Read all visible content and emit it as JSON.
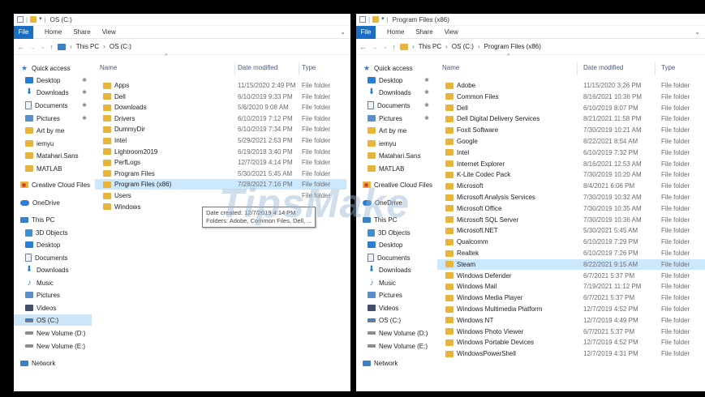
{
  "left": {
    "title": "OS (C:)",
    "ribbon": {
      "file": "File",
      "tabs": [
        "Home",
        "Share",
        "View"
      ]
    },
    "breadcrumb": [
      "This PC",
      "OS (C:)"
    ],
    "columns": {
      "name": "Name",
      "date": "Date modified",
      "type": "Type"
    },
    "nav": [
      {
        "label": "Quick access",
        "icon": "star-icon"
      },
      {
        "label": "Desktop",
        "icon": "desktop-icon",
        "pinned": true
      },
      {
        "label": "Downloads",
        "icon": "download-icon",
        "pinned": true
      },
      {
        "label": "Documents",
        "icon": "documents-icon",
        "pinned": true
      },
      {
        "label": "Pictures",
        "icon": "pictures-icon",
        "pinned": true
      },
      {
        "label": "Art by me",
        "icon": "folder-icon"
      },
      {
        "label": "iemyu",
        "icon": "folder-icon"
      },
      {
        "label": "Matahari.Sans",
        "icon": "folder-icon"
      },
      {
        "label": "MATLAB",
        "icon": "folder-icon"
      },
      {
        "label": "Creative Cloud Files",
        "icon": "creative-cloud-icon"
      },
      {
        "label": "OneDrive",
        "icon": "cloud-icon"
      },
      {
        "label": "This PC",
        "icon": "pc-icon"
      },
      {
        "label": "3D Objects",
        "icon": "cube-icon"
      },
      {
        "label": "Desktop",
        "icon": "desktop-icon"
      },
      {
        "label": "Documents",
        "icon": "documents-icon"
      },
      {
        "label": "Downloads",
        "icon": "download-icon"
      },
      {
        "label": "Music",
        "icon": "music-icon"
      },
      {
        "label": "Pictures",
        "icon": "pictures-icon"
      },
      {
        "label": "Videos",
        "icon": "videos-icon"
      },
      {
        "label": "OS (C:)",
        "icon": "drive-os-icon",
        "selected": true
      },
      {
        "label": "New Volume (D:)",
        "icon": "drive-icon"
      },
      {
        "label": "New Volume (E:)",
        "icon": "drive-icon"
      },
      {
        "label": "Network",
        "icon": "network-icon"
      }
    ],
    "rows": [
      {
        "name": "Apps",
        "date": "11/15/2020 2:49 PM",
        "type": "File folder"
      },
      {
        "name": "Dell",
        "date": "6/10/2019 9:33 PM",
        "type": "File folder"
      },
      {
        "name": "Downloads",
        "date": "5/6/2020 9:08 AM",
        "type": "File folder"
      },
      {
        "name": "Drivers",
        "date": "6/10/2019 7:12 PM",
        "type": "File folder"
      },
      {
        "name": "DummyDir",
        "date": "6/10/2019 7:34 PM",
        "type": "File folder"
      },
      {
        "name": "Intel",
        "date": "5/29/2021 2:53 PM",
        "type": "File folder"
      },
      {
        "name": "Lightroom2019",
        "date": "6/19/2018 3:40 PM",
        "type": "File folder"
      },
      {
        "name": "PerfLogs",
        "date": "12/7/2019 4:14 PM",
        "type": "File folder"
      },
      {
        "name": "Program Files",
        "date": "5/30/2021 5:45 AM",
        "type": "File folder"
      },
      {
        "name": "Program Files (x86)",
        "date": "7/28/2021 7:16 PM",
        "type": "File folder",
        "selected": true
      },
      {
        "name": "Users",
        "date": "",
        "type": "File folder"
      },
      {
        "name": "Windows",
        "date": "",
        "type": ""
      }
    ],
    "tooltip": {
      "line1": "Date created: 12/7/2019 4:14 PM",
      "line2": "Folders: Adobe, Common Files, Dell, ..."
    }
  },
  "right": {
    "title": "Program Files (x86)",
    "ribbon": {
      "file": "File",
      "tabs": [
        "Home",
        "Share",
        "View"
      ]
    },
    "breadcrumb": [
      "This PC",
      "OS (C:)",
      "Program Files (x86)"
    ],
    "columns": {
      "name": "Name",
      "date": "Date modified",
      "type": "Type"
    },
    "nav": [
      {
        "label": "Quick access",
        "icon": "star-icon"
      },
      {
        "label": "Desktop",
        "icon": "desktop-icon",
        "pinned": true
      },
      {
        "label": "Downloads",
        "icon": "download-icon",
        "pinned": true
      },
      {
        "label": "Documents",
        "icon": "documents-icon",
        "pinned": true
      },
      {
        "label": "Pictures",
        "icon": "pictures-icon",
        "pinned": true
      },
      {
        "label": "Art by me",
        "icon": "folder-icon"
      },
      {
        "label": "iemyu",
        "icon": "folder-icon"
      },
      {
        "label": "Matahari.Sans",
        "icon": "folder-icon"
      },
      {
        "label": "MATLAB",
        "icon": "folder-icon"
      },
      {
        "label": "Creative Cloud Files",
        "icon": "creative-cloud-icon"
      },
      {
        "label": "OneDrive",
        "icon": "cloud-icon"
      },
      {
        "label": "This PC",
        "icon": "pc-icon"
      },
      {
        "label": "3D Objects",
        "icon": "cube-icon"
      },
      {
        "label": "Desktop",
        "icon": "desktop-icon"
      },
      {
        "label": "Documents",
        "icon": "documents-icon"
      },
      {
        "label": "Downloads",
        "icon": "download-icon"
      },
      {
        "label": "Music",
        "icon": "music-icon"
      },
      {
        "label": "Pictures",
        "icon": "pictures-icon"
      },
      {
        "label": "Videos",
        "icon": "videos-icon"
      },
      {
        "label": "OS (C:)",
        "icon": "drive-os-icon"
      },
      {
        "label": "New Volume (D:)",
        "icon": "drive-icon"
      },
      {
        "label": "New Volume (E:)",
        "icon": "drive-icon"
      },
      {
        "label": "Network",
        "icon": "network-icon"
      }
    ],
    "rows": [
      {
        "name": "Adobe",
        "date": "11/15/2020 3:26 PM",
        "type": "File folder"
      },
      {
        "name": "Common Files",
        "date": "8/16/2021 10:36 PM",
        "type": "File folder"
      },
      {
        "name": "Dell",
        "date": "6/10/2019 8:07 PM",
        "type": "File folder"
      },
      {
        "name": "Dell Digital Delivery Services",
        "date": "8/21/2021 11:58 PM",
        "type": "File folder"
      },
      {
        "name": "Foxit Software",
        "date": "7/30/2019 10:21 AM",
        "type": "File folder"
      },
      {
        "name": "Google",
        "date": "8/22/2021 8:54 AM",
        "type": "File folder"
      },
      {
        "name": "Intel",
        "date": "6/10/2019 7:32 PM",
        "type": "File folder"
      },
      {
        "name": "Internet Explorer",
        "date": "8/16/2021 12:53 AM",
        "type": "File folder"
      },
      {
        "name": "K-Lite Codec Pack",
        "date": "7/30/2019 10:20 AM",
        "type": "File folder"
      },
      {
        "name": "Microsoft",
        "date": "8/4/2021 6:06 PM",
        "type": "File folder"
      },
      {
        "name": "Microsoft Analysis Services",
        "date": "7/30/2019 10:32 AM",
        "type": "File folder"
      },
      {
        "name": "Microsoft Office",
        "date": "7/30/2019 10:35 AM",
        "type": "File folder"
      },
      {
        "name": "Microsoft SQL Server",
        "date": "7/30/2019 10:36 AM",
        "type": "File folder"
      },
      {
        "name": "Microsoft.NET",
        "date": "5/30/2021 5:45 AM",
        "type": "File folder"
      },
      {
        "name": "Qualcomm",
        "date": "6/10/2019 7:29 PM",
        "type": "File folder"
      },
      {
        "name": "Realtek",
        "date": "6/10/2019 7:26 PM",
        "type": "File folder"
      },
      {
        "name": "Steam",
        "date": "8/22/2021 9:15 AM",
        "type": "File folder",
        "selected": true
      },
      {
        "name": "Windows Defender",
        "date": "6/7/2021 5:37 PM",
        "type": "File folder"
      },
      {
        "name": "Windows Mail",
        "date": "7/19/2021 11:12 PM",
        "type": "File folder"
      },
      {
        "name": "Windows Media Player",
        "date": "6/7/2021 5:37 PM",
        "type": "File folder"
      },
      {
        "name": "Windows Multimedia Platform",
        "date": "12/7/2019 4:52 PM",
        "type": "File folder"
      },
      {
        "name": "Windows NT",
        "date": "12/7/2019 4:49 PM",
        "type": "File folder"
      },
      {
        "name": "Windows Photo Viewer",
        "date": "6/7/2021 5:37 PM",
        "type": "File folder"
      },
      {
        "name": "Windows Portable Devices",
        "date": "12/7/2019 4:52 PM",
        "type": "File folder"
      },
      {
        "name": "WindowsPowerShell",
        "date": "12/7/2019 4:31 PM",
        "type": "File folder"
      }
    ]
  },
  "watermark": "TipsMake",
  "colors": {
    "accent": "#1a6fc4",
    "folder": "#e8b43a",
    "selection": "#cce8ff"
  }
}
